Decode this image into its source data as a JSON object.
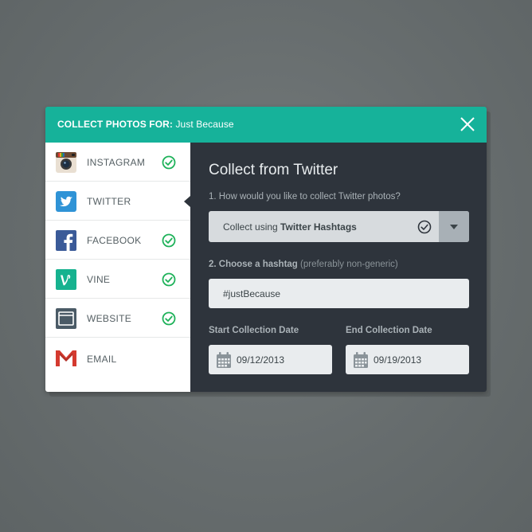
{
  "header": {
    "title_label": "COLLECT PHOTOS FOR:",
    "title_value": "Just Because",
    "background": "#16b29a"
  },
  "sidebar": {
    "items": [
      {
        "label": "INSTAGRAM",
        "icon": "instagram-icon",
        "checked": true
      },
      {
        "label": "TWITTER",
        "icon": "twitter-icon",
        "checked": false,
        "active": true
      },
      {
        "label": "FACEBOOK",
        "icon": "facebook-icon",
        "checked": true
      },
      {
        "label": "VINE",
        "icon": "vine-icon",
        "checked": true
      },
      {
        "label": "WEBSITE",
        "icon": "website-icon",
        "checked": true
      },
      {
        "label": "EMAIL",
        "icon": "gmail-icon",
        "checked": false
      }
    ],
    "check_color": "#1fb25a"
  },
  "panel": {
    "title": "Collect from Twitter",
    "question1": "1. How would you like to collect Twitter photos?",
    "select": {
      "prefix": "Collect using ",
      "value": "Twitter Hashtags"
    },
    "question2_strong": "2. Choose a hashtag",
    "question2_hint": " (preferably non-generic)",
    "hashtag": {
      "value": "#justBecause"
    },
    "start_date": {
      "label": "Start Collection Date",
      "value": "09/12/2013"
    },
    "end_date": {
      "label": "End Collection Date",
      "value": "09/19/2013"
    },
    "background": "#2e343c"
  }
}
